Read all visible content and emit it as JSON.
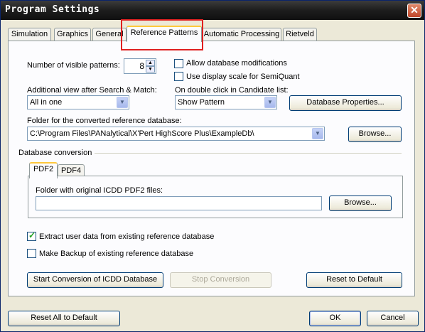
{
  "window": {
    "title": "Program Settings",
    "close_glyph": "✕"
  },
  "tabs": [
    {
      "label": "Simulation",
      "active": false
    },
    {
      "label": "Graphics",
      "active": false
    },
    {
      "label": "General",
      "active": false
    },
    {
      "label": "Reference Patterns",
      "active": true
    },
    {
      "label": "Automatic Processing",
      "active": false
    },
    {
      "label": "Rietveld",
      "active": false
    }
  ],
  "visible_patterns": {
    "label": "Number of visible patterns:",
    "value": "8"
  },
  "allow_db_mod": {
    "label": "Allow database modifications",
    "checked": false
  },
  "use_display_scale": {
    "label": "Use display scale for SemiQuant",
    "checked": false
  },
  "additional_view": {
    "label": "Additional view after Search & Match:",
    "value": "All in one"
  },
  "double_click": {
    "label": "On double click in Candidate list:",
    "value": "Show Pattern"
  },
  "db_properties_button": "Database Properties...",
  "folder": {
    "label": "Folder for the converted reference database:",
    "value": "C:\\Program Files\\PANalytical\\X'Pert HighScore Plus\\ExampleDb\\",
    "browse": "Browse..."
  },
  "db_conversion": {
    "title": "Database conversion",
    "tabs": [
      "PDF2",
      "PDF4"
    ],
    "folder_label": "Folder with original ICDD PDF2 files:",
    "folder_value": "",
    "browse": "Browse..."
  },
  "extract_user_data": {
    "label": "Extract user data from existing reference database",
    "checked": true
  },
  "make_backup": {
    "label": "Make Backup of existing reference database",
    "checked": false
  },
  "buttons": {
    "start_conversion": "Start Conversion of ICDD Database",
    "stop_conversion": "Stop Conversion",
    "reset_default": "Reset to Default",
    "reset_all": "Reset All to Default",
    "ok": "OK",
    "cancel": "Cancel"
  },
  "icons": {
    "combo_arrow": "▼",
    "spin_up": "▲",
    "spin_down": "▼"
  }
}
